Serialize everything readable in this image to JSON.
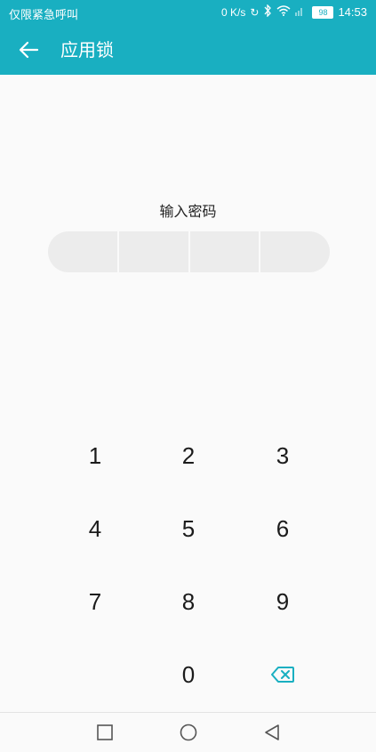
{
  "status_bar": {
    "left_text": "仅限紧急呼叫",
    "net_speed": "0 K/s",
    "battery": "98",
    "time": "14:53",
    "bg_color": "#19afc1"
  },
  "app_bar": {
    "title": "应用锁",
    "back_icon": "arrow-left-icon",
    "bg_color": "#19afc1"
  },
  "lock": {
    "prompt": "输入密码",
    "pin_slots": 4,
    "accent_color": "#19afc1"
  },
  "keypad": {
    "keys": [
      "1",
      "2",
      "3",
      "4",
      "5",
      "6",
      "7",
      "8",
      "9",
      "0"
    ],
    "delete_icon": "backspace-icon"
  },
  "nav_bar": {
    "recent_icon": "square-icon",
    "home_icon": "circle-icon",
    "back_icon": "triangle-back-icon"
  }
}
